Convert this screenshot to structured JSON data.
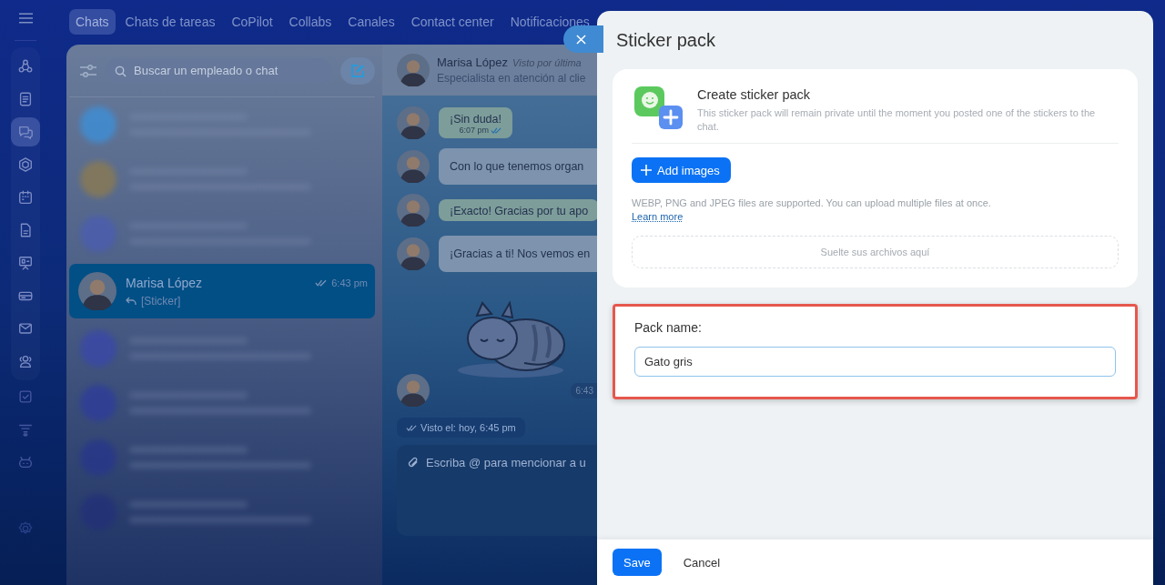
{
  "sidebar": {
    "items": [
      {
        "kind": "flow",
        "selected": false
      },
      {
        "kind": "feed",
        "selected": false
      },
      {
        "kind": "chat",
        "selected": true
      },
      {
        "kind": "hexagon",
        "selected": false
      },
      {
        "kind": "calendar",
        "selected": false
      },
      {
        "kind": "document",
        "selected": false
      },
      {
        "kind": "board",
        "selected": false
      },
      {
        "kind": "drive",
        "selected": false
      },
      {
        "kind": "mail",
        "selected": false
      },
      {
        "kind": "people",
        "selected": false
      },
      {
        "kind": "task",
        "selected": false
      },
      {
        "kind": "funnel",
        "selected": false
      },
      {
        "kind": "bot",
        "selected": false
      },
      {
        "kind": "gear",
        "selected": false
      }
    ]
  },
  "nav_tabs": [
    {
      "label": "Chats",
      "selected": true
    },
    {
      "label": "Chats de tareas",
      "selected": false
    },
    {
      "label": "CoPilot",
      "selected": false
    },
    {
      "label": "Collabs",
      "selected": false
    },
    {
      "label": "Canales",
      "selected": false
    },
    {
      "label": "Contact center",
      "selected": false
    },
    {
      "label": "Notificaciones",
      "selected": false
    }
  ],
  "search": {
    "placeholder": "Buscar un empleado o chat"
  },
  "chats": [
    {
      "kind": "blurred",
      "color": "#3d8fd8"
    },
    {
      "kind": "blurred",
      "color": "#8a7a52"
    },
    {
      "kind": "blurred",
      "color": "#4b5db0"
    },
    {
      "kind": "chat",
      "name": "Marisa López",
      "time": "6:43 pm",
      "preview": "[Sticker]",
      "selected": true
    },
    {
      "kind": "blurred",
      "color": "#3a47a8"
    },
    {
      "kind": "blurred",
      "color": "#2f3c9a"
    },
    {
      "kind": "blurred",
      "color": "#28368a"
    },
    {
      "kind": "blurred",
      "color": "#223078"
    }
  ],
  "conversation": {
    "contact": {
      "name": "Marisa López",
      "seen": "Visto por última",
      "role": "Especialista en atención al clie"
    },
    "messages": [
      {
        "kind": "text",
        "text": "¡Sin duda!",
        "time": "6:07 pm",
        "own": true
      },
      {
        "kind": "text",
        "text": "Con lo que tenemos organ",
        "own": false
      },
      {
        "kind": "text",
        "text": "¡Exacto! Gracias por tu apo",
        "own": true
      },
      {
        "kind": "text",
        "text": "¡Gracias a ti! Nos vemos en",
        "own": false
      },
      {
        "kind": "sticker",
        "time": "6:43"
      }
    ],
    "seen_status": "Visto el: hoy, 6:45 pm",
    "composer": {
      "placeholder": "Escriba @ para mencionar a u"
    }
  },
  "panel": {
    "title": "Sticker pack",
    "card": {
      "title": "Create sticker pack",
      "description": "This sticker pack will remain private until the moment you posted one of the stickers to the chat.",
      "add_button": "Add images",
      "hint": "WEBP, PNG and JPEG files are supported. You can upload multiple files at once.",
      "link": "Learn more",
      "dropzone": "Suelte sus archivos aquí"
    },
    "pack_name": {
      "label": "Pack name:",
      "value": "Gato gris",
      "highlighted": true
    },
    "buttons": [
      {
        "label": "Save",
        "kind": "primary"
      },
      {
        "label": "Cancel",
        "kind": "secondary"
      }
    ]
  }
}
